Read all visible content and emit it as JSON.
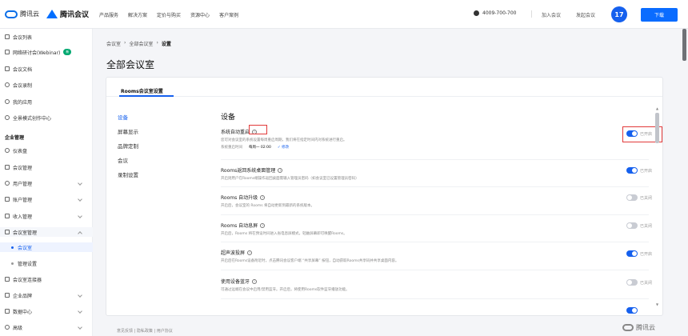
{
  "header": {
    "logo_tencent_cloud": "腾讯云",
    "logo_tencent_meeting": "腾讯会议",
    "nav": [
      "产品服务",
      "解决方案",
      "定价与购买",
      "资源中心",
      "客户案例"
    ],
    "phone": "4009-700-700",
    "join_meeting": "加入会议",
    "host_meeting": "发起会议",
    "avatar_badge": "17",
    "download": "下载"
  },
  "sidebar": {
    "items_top": [
      {
        "label": "会议列表"
      },
      {
        "label": "网络研讨会(Webinar)",
        "badge": "新"
      },
      {
        "label": "会议文档"
      },
      {
        "label": "会议录制"
      },
      {
        "label": "我的应用"
      },
      {
        "label": "全景模式创作中心"
      }
    ],
    "group_title": "企业管理",
    "items_mgmt": [
      {
        "label": "仪表盘"
      },
      {
        "label": "会议管理"
      },
      {
        "label": "用户管理"
      },
      {
        "label": "账户管理"
      },
      {
        "label": "收入管理"
      },
      {
        "label": "会议室管理"
      }
    ],
    "sub_items": [
      {
        "label": "会议室"
      },
      {
        "label": "管理设置"
      }
    ],
    "items_bottom": [
      {
        "label": "会议室连接器"
      },
      {
        "label": "企业品牌"
      },
      {
        "label": "数据中心"
      },
      {
        "label": "高级"
      }
    ]
  },
  "breadcrumb": [
    "会议室",
    "全部会议室",
    "设置"
  ],
  "breadcrumb_sep": "›",
  "page_title": "全部会议室",
  "tab_label": "Rooms会议室设置",
  "left_nav": [
    "设备",
    "屏幕显示",
    "品牌定制",
    "会议",
    "录制设置"
  ],
  "section_title": "设备",
  "settings": [
    {
      "name": "系统自动重启",
      "desc": "您可对会议室的系统设置每周重启周期，我们将在指定时间内对系统进行重启。",
      "time_label": "系统重启时间",
      "time_value": "每周一 02:00",
      "edit": "✓ 修改",
      "state": "已开启",
      "on": true
    },
    {
      "name": "Rooms返回系统桌面管理",
      "desc": "开启则用户在Rooms端操作返回桌面需输入管理员密码（如会议室已设置管理员密码）",
      "state": "已开启",
      "on": true
    },
    {
      "name": "Rooms 自动升级",
      "desc": "开启后，会议室的 Rooms 将自动更新到最新的系统版本。",
      "state": "已关闭",
      "on": false
    },
    {
      "name": "Rooms 自动息屏",
      "desc": "开启后，Rooms 将在预设时间进入省电息屏模式，轻触屏幕即可唤醒Rooms。",
      "state": "已关闭",
      "on": false
    },
    {
      "name": "超声波投屏",
      "desc": "开启后在Rooms设备附近时，点击腾讯会议客户端 “共享屏幕” 按钮，自动获取Rooms共享码并共享桌面内容。",
      "state": "已开启",
      "on": true
    },
    {
      "name": "使用设备蓝牙",
      "desc": "可通过远端在会议中启用/禁用蓝牙。开启后，将使用Rooms软件蓝牙播放功能。",
      "state": "已关闭",
      "on": false
    }
  ],
  "footer_links": "意见反馈 | 隐私政策 | 用户协议",
  "footer_logo": "腾讯云",
  "colors": {
    "accent": "#1560ee",
    "highlight": "#e23a3a",
    "toggle_off": "#c9ccd3"
  }
}
